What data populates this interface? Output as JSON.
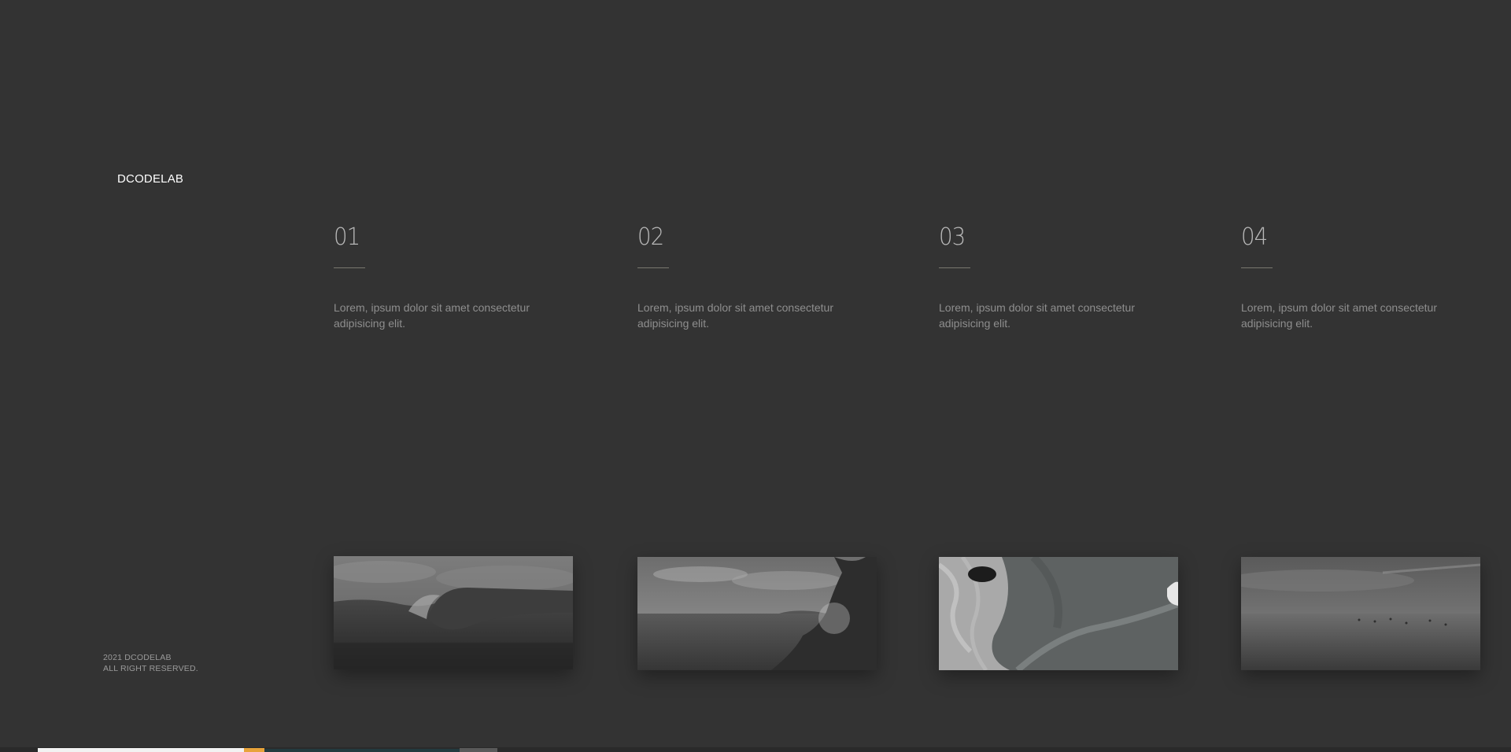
{
  "brand": {
    "logo": "DCODELAB"
  },
  "footer": {
    "line1": "2021 DCODELAB",
    "line2": "ALL RIGHT RESERVED."
  },
  "items": [
    {
      "number": "01",
      "text": "Lorem, ipsum dolor sit amet consectetur adipisicing elit.",
      "image": "wave-image"
    },
    {
      "number": "02",
      "text": "Lorem, ipsum dolor sit amet consectetur adipisicing elit.",
      "image": "coast-image"
    },
    {
      "number": "03",
      "text": "Lorem, ipsum dolor sit amet consectetur adipisicing elit.",
      "image": "aerial-surf-image"
    },
    {
      "number": "04",
      "text": "Lorem, ipsum dolor sit amet consectetur adipisicing elit.",
      "image": "sea-horizon-image"
    }
  ],
  "colors": {
    "background": "#333333",
    "logo": "#ffffff",
    "number": "#b8b8b8",
    "rule": "#7a776f",
    "text": "#8e8e8e"
  }
}
